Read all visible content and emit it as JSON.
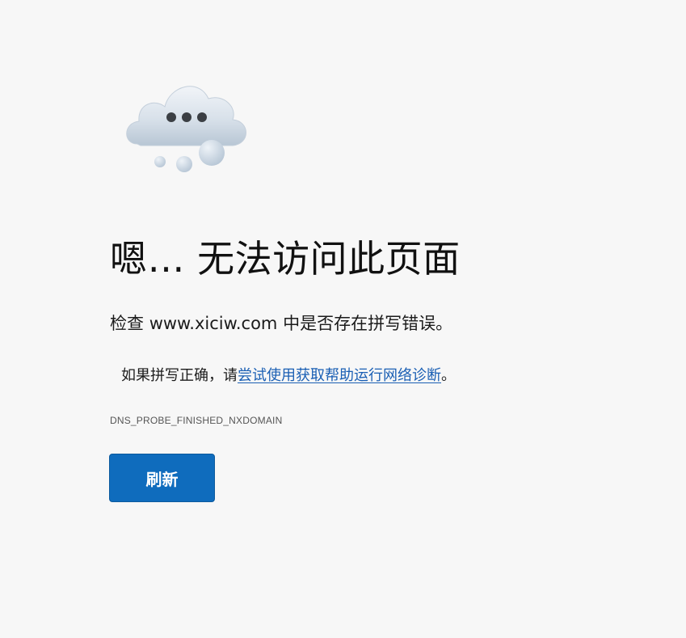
{
  "illustration": {
    "icon": "cloud-thinking-icon"
  },
  "title": "嗯… 无法访问此页面",
  "check": {
    "prefix": "检查 ",
    "domain": "www.xiciw.com",
    "suffix": " 中是否存在拼写错误。"
  },
  "suggestion": {
    "prefix": "如果拼写正确，请",
    "link_text": "尝试使用获取帮助运行网络诊断",
    "suffix": "。"
  },
  "error_code": "DNS_PROBE_FINISHED_NXDOMAIN",
  "refresh_button_label": "刷新",
  "colors": {
    "accent": "#0f6cbd",
    "link": "#1a5fb4",
    "background": "#f7f7f7"
  }
}
